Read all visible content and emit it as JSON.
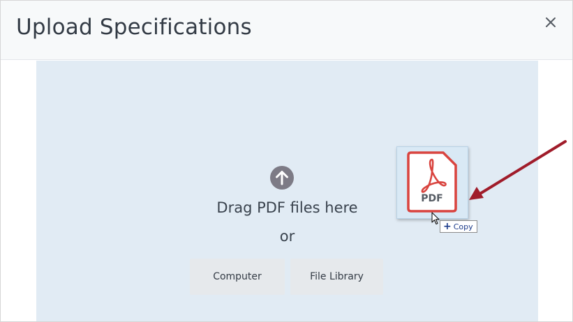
{
  "dialog": {
    "title": "Upload Specifications",
    "close_icon": "close-icon"
  },
  "dropzone": {
    "upload_icon": "arrow-up-circle-icon",
    "drag_text": "Drag PDF files here",
    "or_text": "or",
    "buttons": {
      "computer": "Computer",
      "file_library": "File Library"
    }
  },
  "drag_preview": {
    "file_icon": "pdf-file-icon",
    "file_type_label": "PDF",
    "cursor_icon": "mouse-pointer-icon",
    "tooltip_icon": "plus-icon",
    "tooltip_label": "Copy"
  },
  "annotation": {
    "arrow_icon": "red-arrow-icon",
    "arrow_color": "#a01c2a"
  },
  "colors": {
    "header_bg": "#f7f9fa",
    "dropzone_bg": "#e1ebf4",
    "button_bg": "#e6e9ec",
    "pdf_red": "#d9443f",
    "text": "#39424d"
  }
}
